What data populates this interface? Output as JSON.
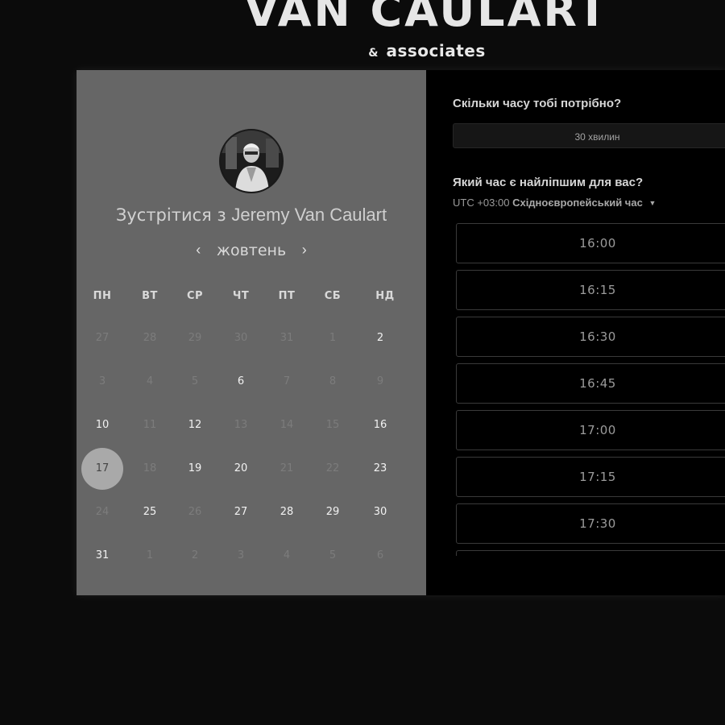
{
  "brand": {
    "title": "VAN CAULART",
    "sub_amp": "&",
    "sub_text": "associates"
  },
  "calendar": {
    "meet_prefix": "Зустрітися з",
    "host_name": "Jeremy Van Caulart",
    "month": "жовтень",
    "prev_icon": "‹",
    "next_icon": "›",
    "weekdays": [
      "ПН",
      "ВТ",
      "СР",
      "ЧТ",
      "ПТ",
      "СБ",
      "НД"
    ],
    "weeks": [
      [
        {
          "d": "27",
          "s": "inactive"
        },
        {
          "d": "28",
          "s": "inactive"
        },
        {
          "d": "29",
          "s": "inactive"
        },
        {
          "d": "30",
          "s": "inactive"
        },
        {
          "d": "31",
          "s": "inactive"
        },
        {
          "d": "1",
          "s": "inactive"
        },
        {
          "d": "2",
          "s": "active"
        }
      ],
      [
        {
          "d": "3",
          "s": "inactive"
        },
        {
          "d": "4",
          "s": "inactive"
        },
        {
          "d": "5",
          "s": "inactive"
        },
        {
          "d": "6",
          "s": "active"
        },
        {
          "d": "7",
          "s": "inactive"
        },
        {
          "d": "8",
          "s": "inactive"
        },
        {
          "d": "9",
          "s": "inactive"
        }
      ],
      [
        {
          "d": "10",
          "s": "active"
        },
        {
          "d": "11",
          "s": "inactive"
        },
        {
          "d": "12",
          "s": "active"
        },
        {
          "d": "13",
          "s": "inactive"
        },
        {
          "d": "14",
          "s": "inactive"
        },
        {
          "d": "15",
          "s": "inactive"
        },
        {
          "d": "16",
          "s": "active"
        }
      ],
      [
        {
          "d": "17",
          "s": "selected"
        },
        {
          "d": "18",
          "s": "inactive"
        },
        {
          "d": "19",
          "s": "active"
        },
        {
          "d": "20",
          "s": "active"
        },
        {
          "d": "21",
          "s": "inactive"
        },
        {
          "d": "22",
          "s": "inactive"
        },
        {
          "d": "23",
          "s": "active"
        }
      ],
      [
        {
          "d": "24",
          "s": "inactive"
        },
        {
          "d": "25",
          "s": "active"
        },
        {
          "d": "26",
          "s": "inactive"
        },
        {
          "d": "27",
          "s": "active"
        },
        {
          "d": "28",
          "s": "active"
        },
        {
          "d": "29",
          "s": "active"
        },
        {
          "d": "30",
          "s": "active"
        }
      ],
      [
        {
          "d": "31",
          "s": "active"
        },
        {
          "d": "1",
          "s": "inactive"
        },
        {
          "d": "2",
          "s": "inactive"
        },
        {
          "d": "3",
          "s": "inactive"
        },
        {
          "d": "4",
          "s": "inactive"
        },
        {
          "d": "5",
          "s": "inactive"
        },
        {
          "d": "6",
          "s": "inactive"
        }
      ]
    ]
  },
  "booking": {
    "duration_question": "Скільки часу тобі потрібно?",
    "duration_value": "30 хвилин",
    "time_question": "Який час є найліпшим для вас?",
    "timezone_offset": "UTC +03:00",
    "timezone_name": "Східноєвропейський час",
    "timezone_caret": "▼",
    "slots": [
      "16:00",
      "16:15",
      "16:30",
      "16:45",
      "17:00",
      "17:15",
      "17:30",
      ""
    ]
  },
  "colors": {
    "page_bg": "#0b0b0b",
    "left_panel": "#666666",
    "right_panel": "#000000",
    "selected_day": "#a9a9a9"
  }
}
